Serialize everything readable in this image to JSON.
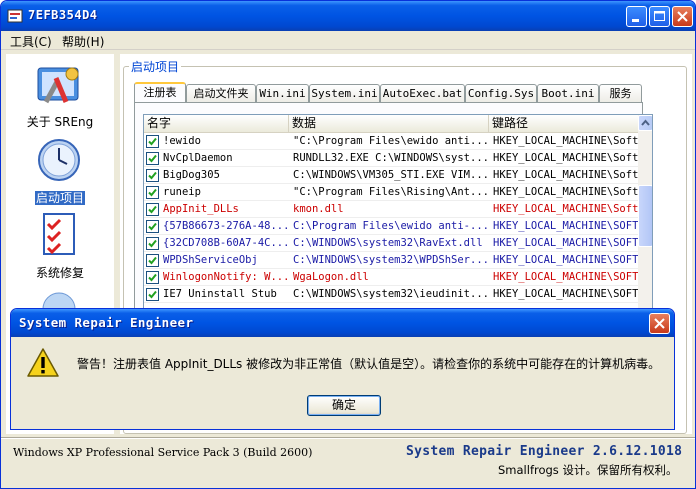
{
  "window": {
    "title": "7EFB354D4"
  },
  "menu": [
    "工具(C)",
    "帮助(H)"
  ],
  "nav": {
    "items": [
      {
        "label": "关于 SREng",
        "icon": "tools-icon"
      },
      {
        "label": "启动项目",
        "icon": "clock-icon",
        "selected": true
      },
      {
        "label": "系统修复",
        "icon": "checklist-icon"
      }
    ]
  },
  "group": {
    "title": "启动项目"
  },
  "tabs": [
    "注册表",
    "启动文件夹",
    "Win.ini",
    "System.ini",
    "AutoExec.bat",
    "Config.Sys",
    "Boot.ini",
    "服务"
  ],
  "table": {
    "columns": [
      "名字",
      "数据",
      "键路径"
    ],
    "rows": [
      {
        "name": "!ewido",
        "data": "\"C:\\Program Files\\ewido anti...",
        "path": "HKEY_LOCAL_MACHINE\\Softw",
        "style": "normal"
      },
      {
        "name": "NvCplDaemon",
        "data": "RUNDLL32.EXE C:\\WINDOWS\\syst...",
        "path": "HKEY_LOCAL_MACHINE\\Softw",
        "style": "normal"
      },
      {
        "name": "BigDog305",
        "data": "C:\\WINDOWS\\VM305_STI.EXE VIM...",
        "path": "HKEY_LOCAL_MACHINE\\Softw",
        "style": "normal"
      },
      {
        "name": "runeip",
        "data": "\"C:\\Program Files\\Rising\\Ant...",
        "path": "HKEY_LOCAL_MACHINE\\Softw",
        "style": "normal"
      },
      {
        "name": "AppInit_DLLs",
        "data": "kmon.dll",
        "path": "HKEY_LOCAL_MACHINE\\Softw",
        "style": "red"
      },
      {
        "name": "{57B86673-276A-48...",
        "data": "C:\\Program Files\\ewido anti-...",
        "path": "HKEY_LOCAL_MACHINE\\SOFTW",
        "style": "blue"
      },
      {
        "name": "{32CD708B-60A7-4C...",
        "data": "C:\\WINDOWS\\system32\\RavExt.dll",
        "path": "HKEY_LOCAL_MACHINE\\SOFTW",
        "style": "blue"
      },
      {
        "name": "WPDShServiceObj",
        "data": "C:\\WINDOWS\\system32\\WPDShSer...",
        "path": "HKEY_LOCAL_MACHINE\\SOFTW",
        "style": "blue"
      },
      {
        "name": "WinlogonNotify: W...",
        "data": "WgaLogon.dll",
        "path": "HKEY_LOCAL_MACHINE\\SOFTW",
        "style": "red"
      },
      {
        "name": "IE7 Uninstall Stub",
        "data": "C:\\WINDOWS\\system32\\ieudinit...",
        "path": "HKEY_LOCAL_MACHINE\\SOFTW",
        "style": "normal"
      }
    ]
  },
  "status": {
    "os": "Windows XP Professional Service Pack 3 (Build 2600)",
    "brand": "System Repair Engineer 2.6.12.1018",
    "copyright": "Smallfrogs 设计。保留所有权利。"
  },
  "dialog": {
    "title": "System Repair Engineer",
    "message": "警告！注册表值 AppInit_DLLs 被修改为非正常值（默认值是空）。请检查你的系统中可能存在的计算机病毒。",
    "ok_label": "确定",
    "icon": "warning-icon"
  },
  "colors": {
    "titlebar": "#0054e3",
    "warning_red": "#cc0000",
    "accent_blue": "#1a1aa6"
  }
}
